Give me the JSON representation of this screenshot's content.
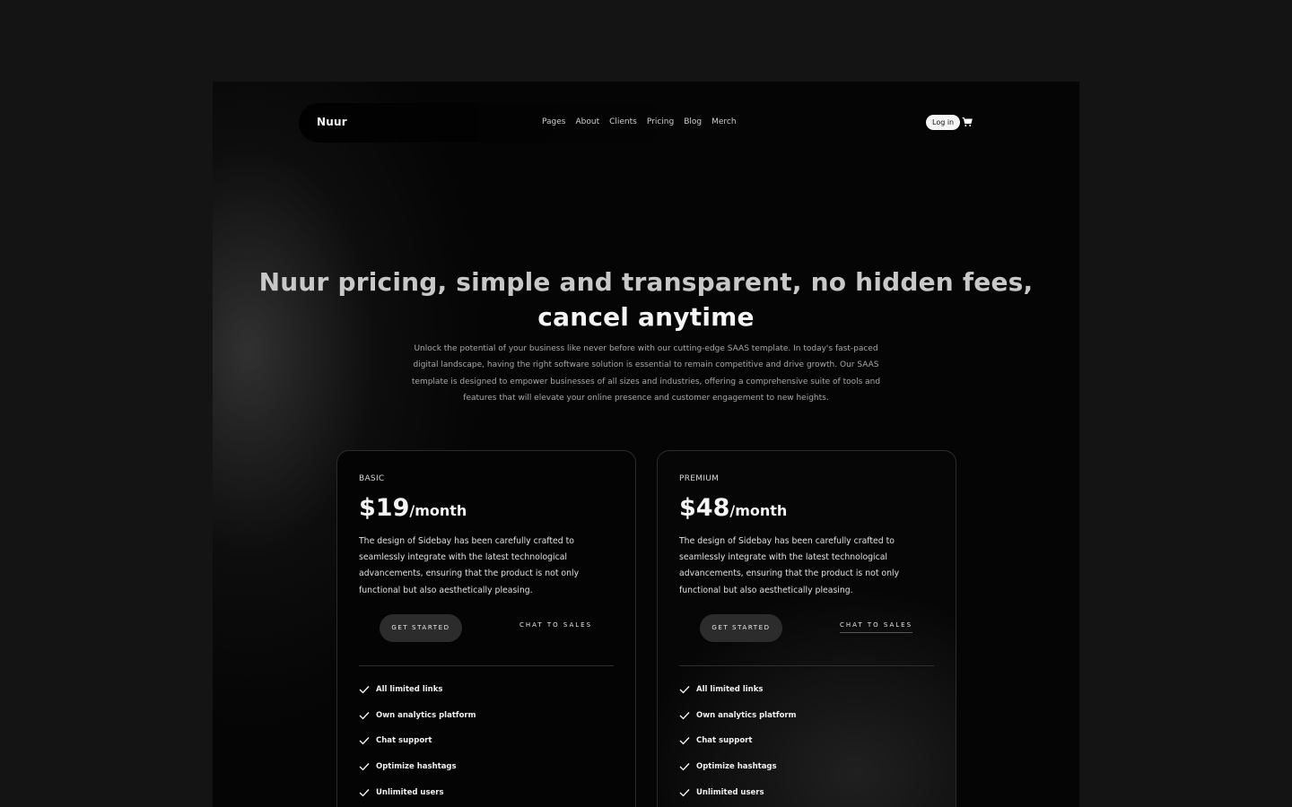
{
  "nav": {
    "brand": "Nuur",
    "items": [
      "Pages",
      "About",
      "Clients",
      "Pricing",
      "Blog",
      "Merch"
    ],
    "login_label": "Log in",
    "cart_icon": "cart-icon"
  },
  "hero": {
    "title_line1": "Nuur pricing, simple and transparent, no hidden fees,",
    "title_line2": "cancel anytime",
    "subtitle": "Unlock the potential of your business like never before with our cutting-edge SAAS template. In today's fast-paced digital landscape, having the right software solution is essential to remain competitive and drive growth. Our SAAS template is designed to empower businesses of all sizes and industries, offering a comprehensive suite of tools and features that will elevate your online presence and customer engagement to new heights."
  },
  "plans": [
    {
      "name": "BASIC",
      "price": "$19",
      "period": "/month",
      "description": "The design of Sidebay has been carefully crafted to seamlessly integrate with the latest technological advancements, ensuring that the product is not only functional but also aesthetically pleasing.",
      "cta_primary": "GET STARTED",
      "cta_secondary": "CHAT TO SALES",
      "features": [
        "All limited links",
        "Own analytics platform",
        "Chat support",
        "Optimize hashtags",
        "Unlimited users"
      ]
    },
    {
      "name": "PREMIUM",
      "price": "$48",
      "period": "/month",
      "description": "The design of Sidebay has been carefully crafted to seamlessly integrate with the latest technological advancements, ensuring that the product is not only functional but also aesthetically pleasing.",
      "cta_primary": "GET STARTED",
      "cta_secondary": "CHAT TO SALES",
      "features": [
        "All limited links",
        "Own analytics platform",
        "Chat support",
        "Optimize hashtags",
        "Unlimited users"
      ]
    }
  ],
  "colors": {
    "background": "#141414",
    "frame": "#050505",
    "button": "#2c2c2c",
    "text": "#f5f5f5"
  }
}
